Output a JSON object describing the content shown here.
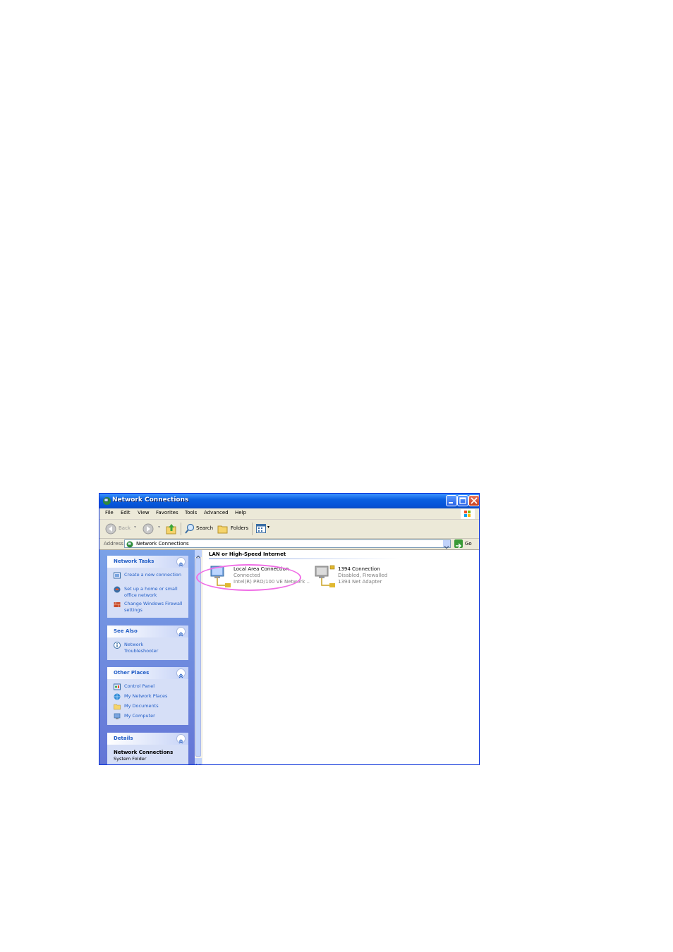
{
  "window": {
    "title": "Network Connections"
  },
  "menu": [
    "File",
    "Edit",
    "View",
    "Favorites",
    "Tools",
    "Advanced",
    "Help"
  ],
  "toolbar": {
    "back_label": "Back",
    "search_label": "Search",
    "folders_label": "Folders"
  },
  "address": {
    "label": "Address",
    "value": "Network Connections",
    "go_label": "Go"
  },
  "sidebar": {
    "network_tasks": {
      "title": "Network Tasks",
      "items": [
        "Create a new connection",
        "Set up a home or small office network",
        "Change Windows Firewall settings"
      ]
    },
    "see_also": {
      "title": "See Also",
      "items": [
        "Network Troubleshooter"
      ]
    },
    "other_places": {
      "title": "Other Places",
      "items": [
        "Control Panel",
        "My Network Places",
        "My Documents",
        "My Computer"
      ]
    },
    "details": {
      "title": "Details",
      "name": "Network Connections",
      "type": "System Folder"
    }
  },
  "content": {
    "group_title": "LAN or High-Speed Internet",
    "connections": [
      {
        "name": "Local Area Connection",
        "status": "Connected",
        "device": "Intel(R) PRO/100 VE Network ..."
      },
      {
        "name": "1394 Connection",
        "status": "Disabled, Firewalled",
        "device": "1394 Net Adapter"
      }
    ]
  },
  "colors": {
    "titlebar": "#0553d8",
    "sidebar_link": "#215dc6",
    "highlight_ellipse": "#f06ee6"
  }
}
